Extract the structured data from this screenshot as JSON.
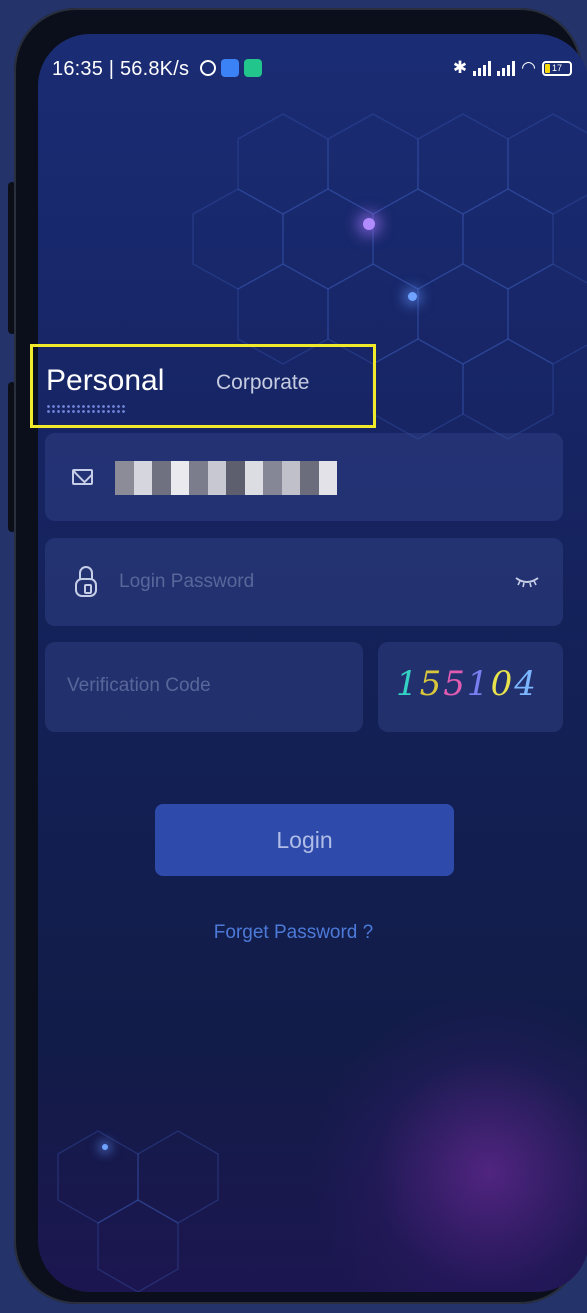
{
  "status_bar": {
    "time_speed": "16:35 | 56.8K/s",
    "battery_level": "17",
    "icons": [
      "alarm-icon",
      "app-icon-blue",
      "app-icon-green",
      "bluetooth-icon",
      "signal-icon",
      "signal-icon",
      "wifi-icon",
      "battery-icon"
    ]
  },
  "tabs": {
    "personal": "Personal",
    "corporate": "Corporate",
    "active": "Personal",
    "highlight_color": "#f0ea2a"
  },
  "form": {
    "username_value_hidden": true,
    "password_placeholder": "Login Password",
    "verification_placeholder": "Verification Code",
    "captcha": [
      "1",
      "5",
      "5",
      "1",
      "0",
      "4"
    ],
    "captcha_colors": [
      "#34d1c5",
      "#d9c63b",
      "#e05cb0",
      "#7a7ef0",
      "#e8e24c",
      "#7bb6ff"
    ]
  },
  "actions": {
    "login_label": "Login",
    "forgot_label": "Forget Password ?"
  },
  "colors": {
    "accent": "#2e4bab",
    "link": "#4d7ad9",
    "background": "#172565"
  }
}
